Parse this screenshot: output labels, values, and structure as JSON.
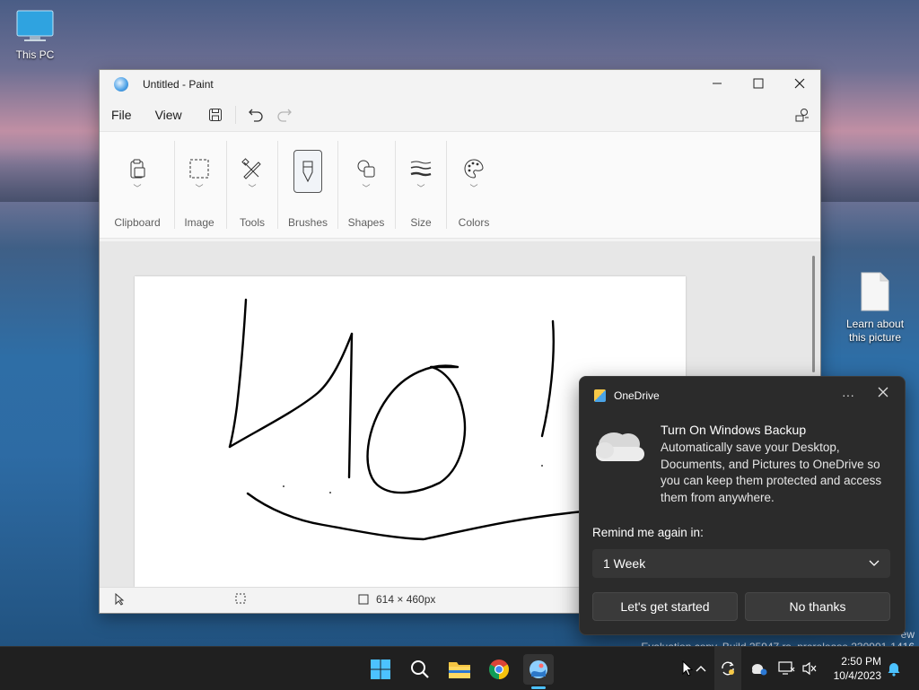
{
  "desktop": {
    "icons": [
      {
        "label": "This PC",
        "icon": "monitor-icon"
      },
      {
        "label": "Learn about this picture",
        "icon": "document-icon"
      }
    ]
  },
  "paint": {
    "title": "Untitled - Paint",
    "menu": [
      "File",
      "View"
    ],
    "toolbar_icons": [
      "save-icon",
      "undo-icon",
      "redo-icon",
      "settings-icon"
    ],
    "groups": [
      {
        "label": "Clipboard",
        "icon": "clipboard-icon"
      },
      {
        "label": "Image",
        "icon": "selection-icon"
      },
      {
        "label": "Tools",
        "icon": "pencil-icon"
      },
      {
        "label": "Brushes",
        "icon": "brush-icon",
        "selected": true
      },
      {
        "label": "Shapes",
        "icon": "shapes-icon"
      },
      {
        "label": "Size",
        "icon": "line-size-icon"
      },
      {
        "label": "Colors",
        "icon": "palette-icon"
      }
    ],
    "status": {
      "canvas_size": "614 × 460px"
    },
    "drawing": {
      "text": "Hi0!",
      "stroke_color": "#000000"
    }
  },
  "onedrive": {
    "app_name": "OneDrive",
    "title": "Turn On Windows Backup",
    "body": "Automatically save your Desktop, Documents, and Pictures to OneDrive so you can keep them protected and access them from anywhere.",
    "remind_label": "Remind me again in:",
    "remind_value": "1 Week",
    "primary_button": "Let's get started",
    "secondary_button": "No thanks"
  },
  "watermark": {
    "line1": "ew",
    "line2": "Evaluation copy. Build 25947.rs_prerelease.230901-1416"
  },
  "taskbar": {
    "apps": [
      "start-icon",
      "search-icon",
      "file-explorer-icon",
      "chrome-icon",
      "paint-icon"
    ],
    "time": "2:50 PM",
    "date": "10/4/2023"
  }
}
